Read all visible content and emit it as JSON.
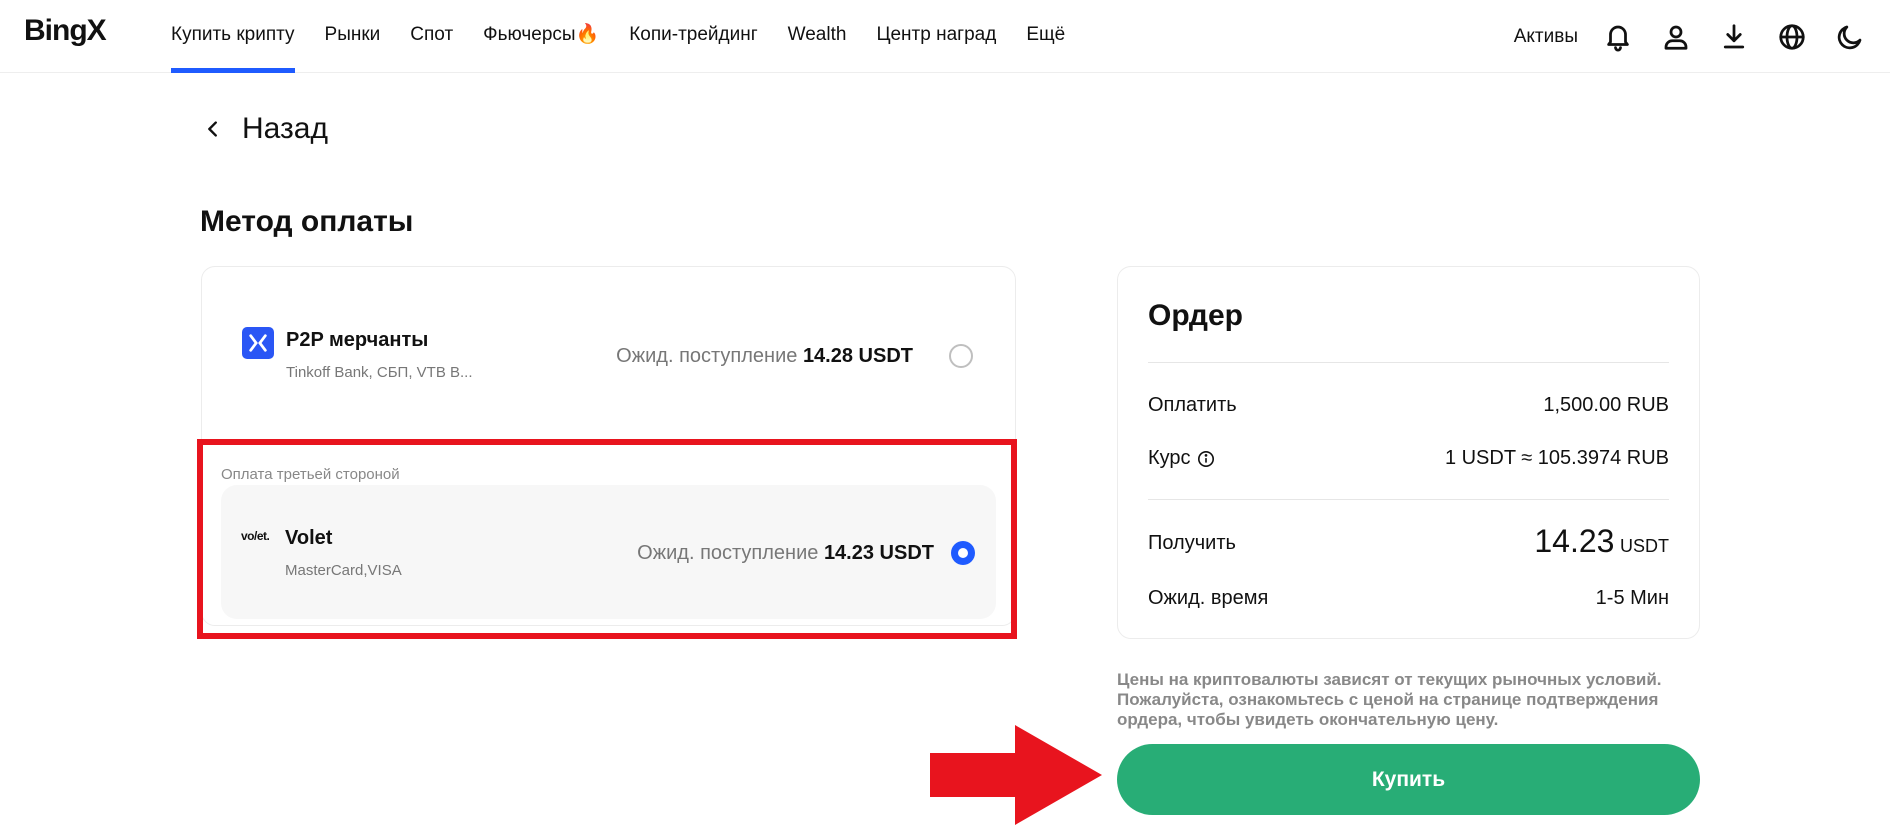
{
  "nav": {
    "logo": "BingX",
    "items": [
      {
        "label": "Купить крипту",
        "active": true
      },
      {
        "label": "Рынки"
      },
      {
        "label": "Спот"
      },
      {
        "label": "Фьючерсы🔥"
      },
      {
        "label": "Копи-трейдинг"
      },
      {
        "label": "Wealth"
      },
      {
        "label": "Центр наград"
      },
      {
        "label": "Ещё"
      }
    ],
    "assets": "Активы",
    "icons": [
      "bell-icon",
      "user-icon",
      "download-icon",
      "globe-icon",
      "moon-icon"
    ]
  },
  "back_label": "Назад",
  "payment": {
    "title": "Метод оплаты",
    "methods": [
      {
        "name": "P2P мерчанты",
        "sub": "Tinkoff Bank, СБП, VTB B...",
        "expect_label": "Ожид. поступление",
        "expect_amount": "14.28 USDT",
        "selected": false
      },
      {
        "group_label": "Оплата третьей стороной",
        "logo_text": "vo/et.",
        "name": "Volet",
        "sub": "MasterCard,VISA",
        "expect_label": "Ожид. поступление",
        "expect_amount": "14.23 USDT",
        "selected": true
      }
    ]
  },
  "order": {
    "title": "Ордер",
    "pay_label": "Оплатить",
    "pay_value": "1,500.00 RUB",
    "rate_label": "Курс",
    "rate_value": "1 USDT ≈ 105.3974 RUB",
    "receive_label": "Получить",
    "receive_amount": "14.23",
    "receive_unit": "USDT",
    "time_label": "Ожид. время",
    "time_value": "1-5 Мин"
  },
  "disclaimer": "Цены на криптовалюты зависят от текущих рыночных условий. Пожалуйста, ознакомьтесь с ценой на странице подтверждения ордера, чтобы увидеть окончательную цену.",
  "buy_label": "Купить",
  "colors": {
    "accent": "#1f5bff",
    "buy": "#28ad76",
    "highlight": "#e8141e"
  }
}
